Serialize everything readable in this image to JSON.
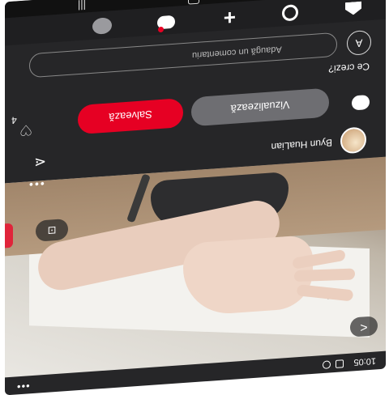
{
  "status": {
    "time": "10:05"
  },
  "video": {
    "back_glyph": "<",
    "lens_glyph": "⊡",
    "more_glyph": "•••"
  },
  "author": {
    "name": "Byun HuaLian"
  },
  "actions": {
    "view_label": "Vizualizează",
    "save_label": "Salvează",
    "likes_count": "4"
  },
  "comments": {
    "prompt": "Ce crezi?",
    "avatar_initial": "A",
    "input_placeholder": "Adaugă un comentariu"
  },
  "icons": {
    "share": "share-icon",
    "chat": "chat-icon",
    "heart": "heart-icon",
    "home": "home-icon",
    "search": "search-icon",
    "plus": "plus-icon",
    "messages": "messages-icon",
    "profile": "profile-icon"
  },
  "colors": {
    "accent": "#e60023",
    "background": "#262628"
  }
}
